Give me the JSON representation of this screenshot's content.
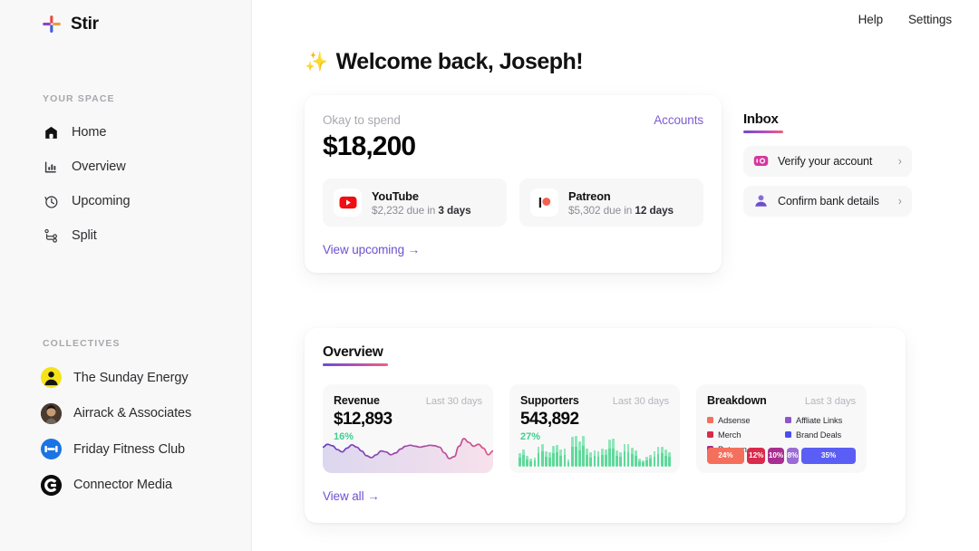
{
  "brand": {
    "name": "Stir",
    "logo_icon": "stir-plus-logo"
  },
  "topbar": {
    "help": "Help",
    "settings": "Settings"
  },
  "page": {
    "greeting": "Welcome back, Joseph!",
    "sparkle": "✨"
  },
  "sidebar": {
    "space_label": "YOUR SPACE",
    "nav": [
      {
        "label": "Home",
        "icon": "home-icon"
      },
      {
        "label": "Overview",
        "icon": "bar-chart-icon"
      },
      {
        "label": "Upcoming",
        "icon": "clock-icon"
      },
      {
        "label": "Split",
        "icon": "split-nodes-icon"
      }
    ],
    "collectives_label": "COLLECTIVES",
    "collectives": [
      {
        "label": "The Sunday Energy",
        "avatar": "yellow-person-avatar",
        "color": "#f5e318"
      },
      {
        "label": "Airrack & Associates",
        "avatar": "photo-avatar",
        "color": "#2b2118"
      },
      {
        "label": "Friday Fitness Club",
        "avatar": "dumbbell-avatar",
        "color": "#1b74e4"
      },
      {
        "label": "Connector Media",
        "avatar": "letter-c-avatar",
        "color": "#0c0c0c"
      }
    ]
  },
  "spend": {
    "label": "Okay to spend",
    "accounts_link": "Accounts",
    "amount": "$18,200",
    "bills": [
      {
        "name": "YouTube",
        "icon": "youtube-icon",
        "amount": "$2,232",
        "due_prefix": "due in",
        "due": "3 days"
      },
      {
        "name": "Patreon",
        "icon": "patreon-icon",
        "amount": "$5,302",
        "due_prefix": "due in",
        "due": "12 days"
      }
    ],
    "view_upcoming": "View upcoming →"
  },
  "inbox": {
    "title": "Inbox",
    "items": [
      {
        "label": "Verify your account",
        "icon": "id-card-icon",
        "chevron": "›"
      },
      {
        "label": "Confirm bank details",
        "icon": "person-icon",
        "chevron": "›"
      }
    ]
  },
  "overview": {
    "title": "Overview",
    "view_all": "View all →",
    "revenue": {
      "name": "Revenue",
      "period": "Last 30 days",
      "value": "$12,893",
      "delta": "16%"
    },
    "supporters": {
      "name": "Supporters",
      "period": "Last 30 days",
      "value": "543,892",
      "delta": "27%"
    },
    "breakdown": {
      "name": "Breakdown",
      "period": "Last 3 days",
      "legend": [
        {
          "label": "Adsense",
          "color": "#f4705c"
        },
        {
          "label": "Affliate Links",
          "color": "#8e56c8"
        },
        {
          "label": "Merch",
          "color": "#d92b4b"
        },
        {
          "label": "Brand Deals",
          "color": "#4a4ef0"
        },
        {
          "label": "Patreon",
          "color": "#a82e8f"
        }
      ]
    }
  },
  "chart_data": [
    {
      "type": "area",
      "title": "Revenue",
      "subtitle": "Last 30 days",
      "ylabel": "",
      "xlabel": "",
      "total": 12893,
      "delta_pct": 16,
      "stroke_gradient": [
        "#6a3fc0",
        "#d9568b"
      ],
      "fill_gradient": [
        "#ddd8ef",
        "#f6e2ec"
      ],
      "x": [
        1,
        2,
        3,
        4,
        5,
        6,
        7,
        8,
        9,
        10,
        11,
        12,
        13,
        14,
        15,
        16,
        17,
        18,
        19,
        20,
        21,
        22,
        23,
        24,
        25,
        26,
        27,
        28,
        29,
        30,
        31,
        32,
        33,
        34,
        35,
        36
      ],
      "values": [
        60,
        66,
        63,
        55,
        50,
        58,
        65,
        60,
        52,
        42,
        38,
        44,
        52,
        50,
        44,
        48,
        56,
        62,
        64,
        62,
        60,
        62,
        64,
        63,
        60,
        48,
        36,
        40,
        62,
        78,
        70,
        62,
        66,
        58,
        44,
        52
      ]
    },
    {
      "type": "bar",
      "title": "Supporters",
      "subtitle": "Last 30 days",
      "total": 543892,
      "delta_pct": 27,
      "color": "#5fd99a",
      "cap_color": "#8ee6b9",
      "categories": [
        "1",
        "2",
        "3",
        "4",
        "5",
        "6",
        "7",
        "8",
        "9",
        "10",
        "11",
        "12",
        "13",
        "14",
        "15",
        "16",
        "17",
        "18",
        "19",
        "20",
        "21",
        "22",
        "23",
        "24",
        "25",
        "26",
        "27",
        "28",
        "29",
        "30",
        "31",
        "32",
        "33",
        "34",
        "35",
        "36",
        "37",
        "38",
        "39",
        "40",
        "41"
      ],
      "values": [
        38,
        50,
        30,
        22,
        26,
        58,
        66,
        44,
        40,
        60,
        62,
        48,
        52,
        20,
        86,
        88,
        72,
        90,
        52,
        40,
        46,
        44,
        52,
        50,
        78,
        80,
        46,
        42,
        66,
        64,
        54,
        46,
        22,
        18,
        28,
        34,
        44,
        56,
        58,
        48,
        42
      ]
    },
    {
      "type": "bar",
      "title": "Breakdown",
      "subtitle": "Last 3 days",
      "orientation": "horizontal-stacked",
      "categories": [
        "Adsense",
        "Merch",
        "Patreon",
        "Affliate Links",
        "Brand Deals"
      ],
      "values": [
        24,
        12,
        10,
        8,
        35
      ],
      "labels": [
        "24%",
        "12%",
        "10%",
        "8%",
        "35%"
      ],
      "colors": [
        "#f4705c",
        "#d92b4b",
        "#a82e8f",
        "#9b6bd4",
        "#5a5ef5"
      ]
    }
  ]
}
